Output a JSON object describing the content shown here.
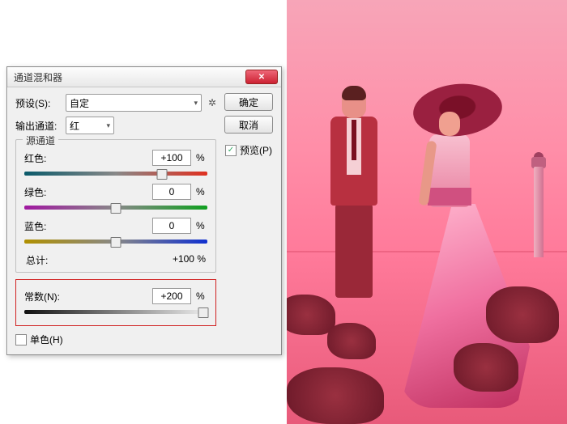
{
  "dialog": {
    "title": "通道混和器",
    "preset_label": "预设(S):",
    "preset_value": "自定",
    "output_label": "输出通道:",
    "output_value": "红",
    "ok": "确定",
    "cancel": "取消",
    "preview": "预览(P)",
    "group_legend": "源通道",
    "red_label": "红色:",
    "red_value": "+100",
    "green_label": "绿色:",
    "green_value": "0",
    "blue_label": "蓝色:",
    "blue_value": "0",
    "pct": "%",
    "total_label": "总计:",
    "total_value": "+100",
    "constant_label": "常数(N):",
    "constant_value": "+200",
    "mono_label": "单色(H)"
  },
  "sliders": {
    "red_pos": "75%",
    "green_pos": "50%",
    "blue_pos": "50%",
    "const_pos": "98%"
  }
}
